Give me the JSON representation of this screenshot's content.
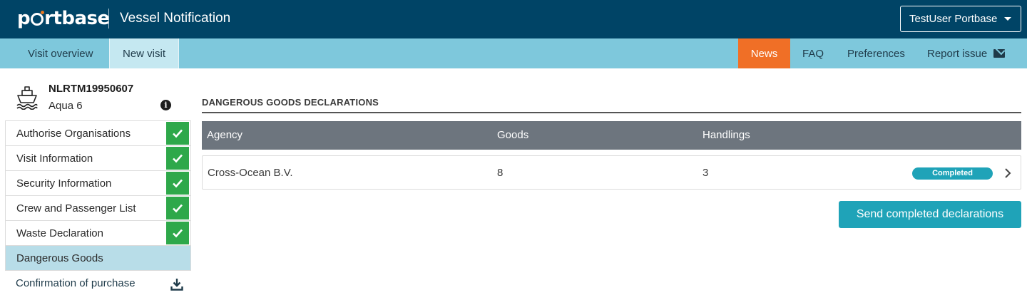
{
  "header": {
    "logo_text_left": "p",
    "logo_text_right": "rtbase",
    "app_title": "Vessel Notification",
    "user_menu": "TestUser Portbase"
  },
  "nav": {
    "left": [
      "Visit overview",
      "New visit"
    ],
    "right": [
      "News",
      "FAQ",
      "Preferences",
      "Report issue"
    ],
    "active": "New visit",
    "highlight": "News",
    "colors": {
      "topbar": "#004466",
      "navbar": "#7ec8dc",
      "news": "#f06f26",
      "active_tab": "#c5e8f1"
    }
  },
  "vessel": {
    "crn": "NLRTM19950607",
    "name": "Aqua 6",
    "icons": [
      "ship-icon",
      "info-icon"
    ]
  },
  "steps": [
    {
      "label": "Authorise Organisations",
      "completed": true
    },
    {
      "label": "Visit Information",
      "completed": true
    },
    {
      "label": "Security Information",
      "completed": true
    },
    {
      "label": "Crew and Passenger List",
      "completed": true
    },
    {
      "label": "Waste Declaration",
      "completed": true
    },
    {
      "label": "Dangerous Goods",
      "completed": false,
      "active": true
    }
  ],
  "confirmation": {
    "label": "Confirmation of purchase",
    "icon": "download-icon"
  },
  "main": {
    "section_title": "DANGEROUS GOODS DECLARATIONS",
    "columns": [
      "Agency",
      "Goods",
      "Handlings"
    ],
    "rows": [
      {
        "agency": "Cross-Ocean B.V.",
        "goods": "8",
        "handlings": "3",
        "status": "Completed"
      }
    ],
    "send_button": "Send completed declarations",
    "colors": {
      "header": "#6d757e",
      "accent": "#1fa3b8",
      "check": "#2ea84a"
    }
  }
}
